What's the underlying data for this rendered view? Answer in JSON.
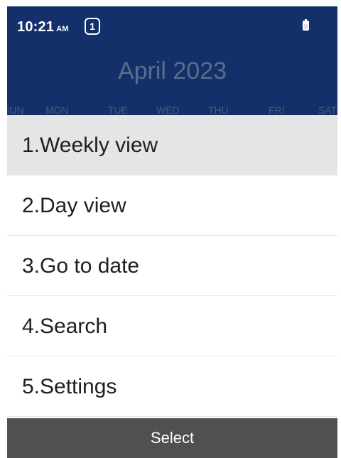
{
  "status": {
    "time": "10:21",
    "ampm": "AM",
    "sim_slot": "1"
  },
  "calendar": {
    "month_title": "April 2023",
    "weekdays": [
      "SUN",
      "MON",
      "TUE",
      "WED",
      "THU",
      "FRI",
      "SAT"
    ]
  },
  "menu": {
    "items": [
      {
        "label": "1.Weekly view",
        "selected": true
      },
      {
        "label": "2.Day view"
      },
      {
        "label": "3.Go to date"
      },
      {
        "label": "4.Search"
      },
      {
        "label": "5.Settings"
      }
    ]
  },
  "softkeys": {
    "center": "Select"
  },
  "colors": {
    "header": "#13306b",
    "selected_row": "#e5e5e5",
    "softkey_bar": "#505050"
  }
}
